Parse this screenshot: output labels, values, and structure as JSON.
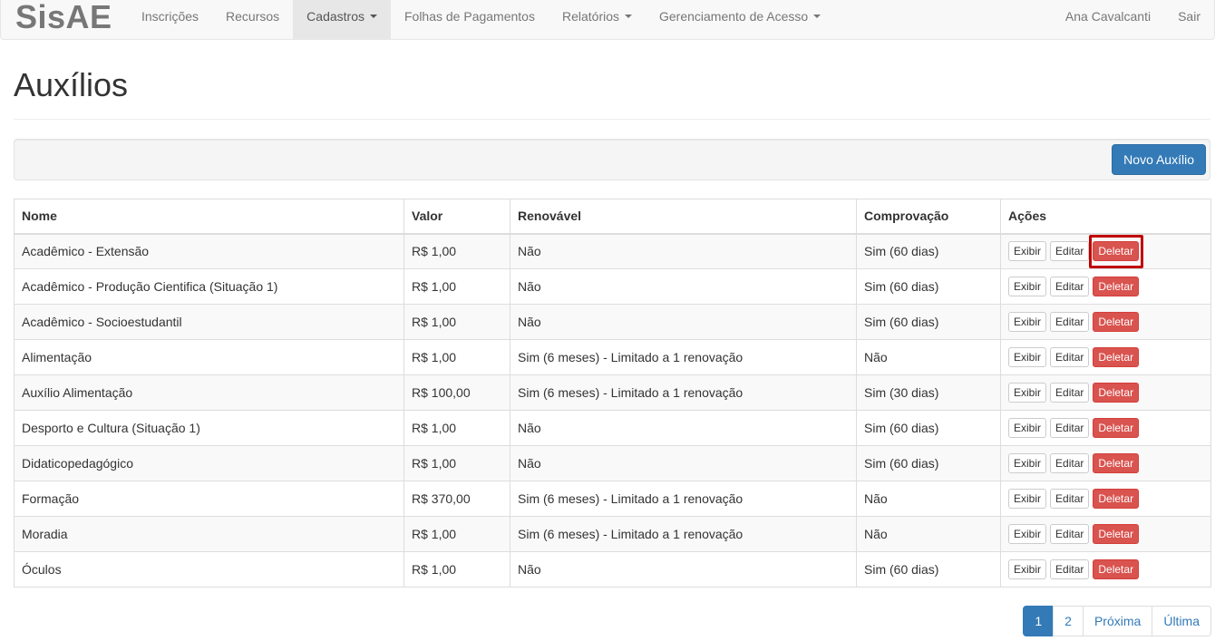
{
  "navbar": {
    "brand": "SisAE",
    "items": [
      {
        "label": "Inscrições",
        "dropdown": false,
        "active": false
      },
      {
        "label": "Recursos",
        "dropdown": false,
        "active": false
      },
      {
        "label": "Cadastros",
        "dropdown": true,
        "active": true
      },
      {
        "label": "Folhas de Pagamentos",
        "dropdown": false,
        "active": false
      },
      {
        "label": "Relatórios",
        "dropdown": true,
        "active": false
      },
      {
        "label": "Gerenciamento de Acesso",
        "dropdown": true,
        "active": false
      }
    ],
    "user": "Ana Cavalcanti",
    "logout": "Sair"
  },
  "page": {
    "title": "Auxílios"
  },
  "toolbar": {
    "new_label": "Novo Auxílio"
  },
  "table": {
    "headers": [
      "Nome",
      "Valor",
      "Renovável",
      "Comprovação",
      "Ações"
    ],
    "action_labels": {
      "show": "Exibir",
      "edit": "Editar",
      "delete": "Deletar"
    },
    "rows": [
      {
        "nome": "Acadêmico - Extensão",
        "valor": "R$ 1,00",
        "renovavel": "Não",
        "comprovacao": "Sim (60 dias)"
      },
      {
        "nome": "Acadêmico - Produção Cientifica (Situação 1)",
        "valor": "R$ 1,00",
        "renovavel": "Não",
        "comprovacao": "Sim (60 dias)"
      },
      {
        "nome": "Acadêmico - Socioestudantil",
        "valor": "R$ 1,00",
        "renovavel": "Não",
        "comprovacao": "Sim (60 dias)"
      },
      {
        "nome": "Alimentação",
        "valor": "R$ 1,00",
        "renovavel": "Sim (6 meses) - Limitado a 1 renovação",
        "comprovacao": "Não"
      },
      {
        "nome": "Auxílio Alimentação",
        "valor": "R$ 100,00",
        "renovavel": "Sim (6 meses) - Limitado a 1 renovação",
        "comprovacao": "Sim (30 dias)"
      },
      {
        "nome": "Desporto e Cultura (Situação 1)",
        "valor": "R$ 1,00",
        "renovavel": "Não",
        "comprovacao": "Sim (60 dias)"
      },
      {
        "nome": "Didaticopedagógico",
        "valor": "R$ 1,00",
        "renovavel": "Não",
        "comprovacao": "Sim (60 dias)"
      },
      {
        "nome": "Formação",
        "valor": "R$ 370,00",
        "renovavel": "Sim (6 meses) - Limitado a 1 renovação",
        "comprovacao": "Não"
      },
      {
        "nome": "Moradia",
        "valor": "R$ 1,00",
        "renovavel": "Sim (6 meses) - Limitado a 1 renovação",
        "comprovacao": "Não"
      },
      {
        "nome": "Óculos",
        "valor": "R$ 1,00",
        "renovavel": "Não",
        "comprovacao": "Sim (60 dias)"
      }
    ]
  },
  "pagination": {
    "pages": [
      "1",
      "2"
    ],
    "current": "1",
    "next": "Próxima",
    "last": "Última"
  },
  "colors": {
    "primary": "#337ab7",
    "danger": "#d9534f",
    "highlight": "#c00000"
  }
}
